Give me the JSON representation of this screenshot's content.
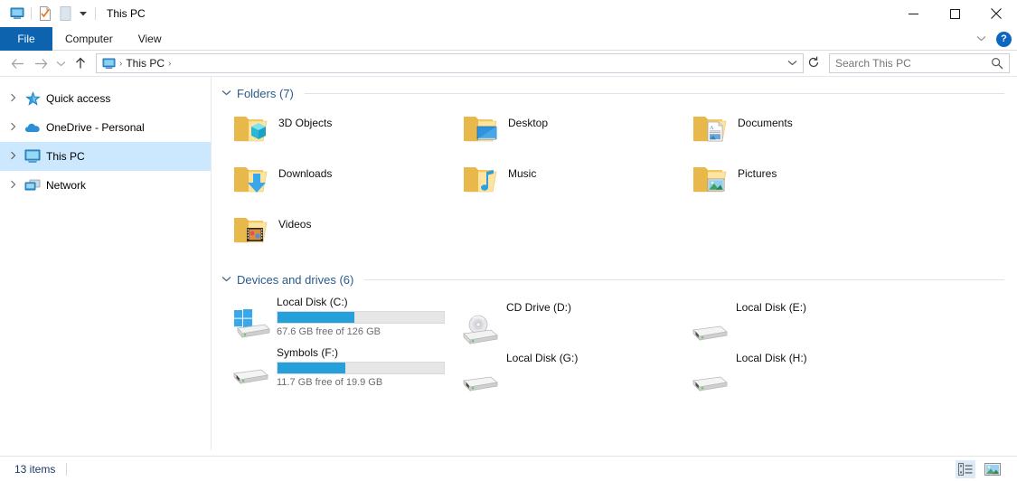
{
  "window": {
    "title": "This PC",
    "controls": {
      "minimize": "—",
      "maximize": "□",
      "close": "✕"
    },
    "quick_access": {
      "pc_icon": "monitor-icon",
      "properties_icon": "properties-icon",
      "new_folder_icon": "new-item-icon",
      "dropdown": "▾"
    }
  },
  "ribbon": {
    "tabs": [
      {
        "label": "File",
        "active": true
      },
      {
        "label": "Computer",
        "active": false
      },
      {
        "label": "View",
        "active": false
      }
    ],
    "collapse_chevron": "⌄",
    "help_label": "?"
  },
  "address": {
    "back": "←",
    "forward": "→",
    "recent": "⌄",
    "up": "↑",
    "crumbs": [
      "This PC"
    ],
    "crumb_sep": "›",
    "dropdown": "⌄",
    "refresh": "↻"
  },
  "search": {
    "placeholder": "Search This PC",
    "icon": "search-icon"
  },
  "sidebar": {
    "items": [
      {
        "label": "Quick access",
        "icon": "star-icon",
        "chevron": "›",
        "selected": false
      },
      {
        "label": "OneDrive - Personal",
        "icon": "cloud-icon",
        "chevron": "›",
        "selected": false
      },
      {
        "label": "This PC",
        "icon": "monitor-icon",
        "chevron": "›",
        "selected": true
      },
      {
        "label": "Network",
        "icon": "network-icon",
        "chevron": "›",
        "selected": false
      }
    ]
  },
  "folders_group": {
    "chevron": "⌄",
    "title": "Folders (7)",
    "items": [
      {
        "label": "3D Objects",
        "icon": "folder-3dobjects-icon"
      },
      {
        "label": "Desktop",
        "icon": "folder-desktop-icon"
      },
      {
        "label": "Documents",
        "icon": "folder-documents-icon"
      },
      {
        "label": "Downloads",
        "icon": "folder-downloads-icon"
      },
      {
        "label": "Music",
        "icon": "folder-music-icon"
      },
      {
        "label": "Pictures",
        "icon": "folder-pictures-icon"
      },
      {
        "label": "Videos",
        "icon": "folder-videos-icon"
      }
    ]
  },
  "drives_group": {
    "chevron": "⌄",
    "title": "Devices and drives (6)",
    "items": [
      {
        "label": "Local Disk (C:)",
        "icon": "windows-drive-icon",
        "has_bar": true,
        "fill_percent": 46,
        "free_text": "67.6 GB free of 126 GB"
      },
      {
        "label": "CD Drive (D:)",
        "icon": "cd-drive-icon",
        "has_bar": false,
        "fill_percent": 0,
        "free_text": ""
      },
      {
        "label": "Local Disk (E:)",
        "icon": "hard-drive-icon",
        "has_bar": false,
        "fill_percent": 0,
        "free_text": ""
      },
      {
        "label": "Symbols (F:)",
        "icon": "hard-drive-icon",
        "has_bar": true,
        "fill_percent": 41,
        "free_text": "11.7 GB free of 19.9 GB"
      },
      {
        "label": "Local Disk (G:)",
        "icon": "hard-drive-icon",
        "has_bar": false,
        "fill_percent": 0,
        "free_text": ""
      },
      {
        "label": "Local Disk (H:)",
        "icon": "hard-drive-icon",
        "has_bar": false,
        "fill_percent": 0,
        "free_text": ""
      }
    ]
  },
  "statusbar": {
    "item_count": "13 items",
    "views": [
      {
        "name": "details-view",
        "active": true
      },
      {
        "name": "large-icons-view",
        "active": false
      }
    ]
  },
  "colors": {
    "accent": "#0d63ad",
    "selection": "#cce8ff",
    "bar_fill": "#26a0da",
    "group_title": "#2a5a8a",
    "status_text": "#1a3a6a"
  }
}
